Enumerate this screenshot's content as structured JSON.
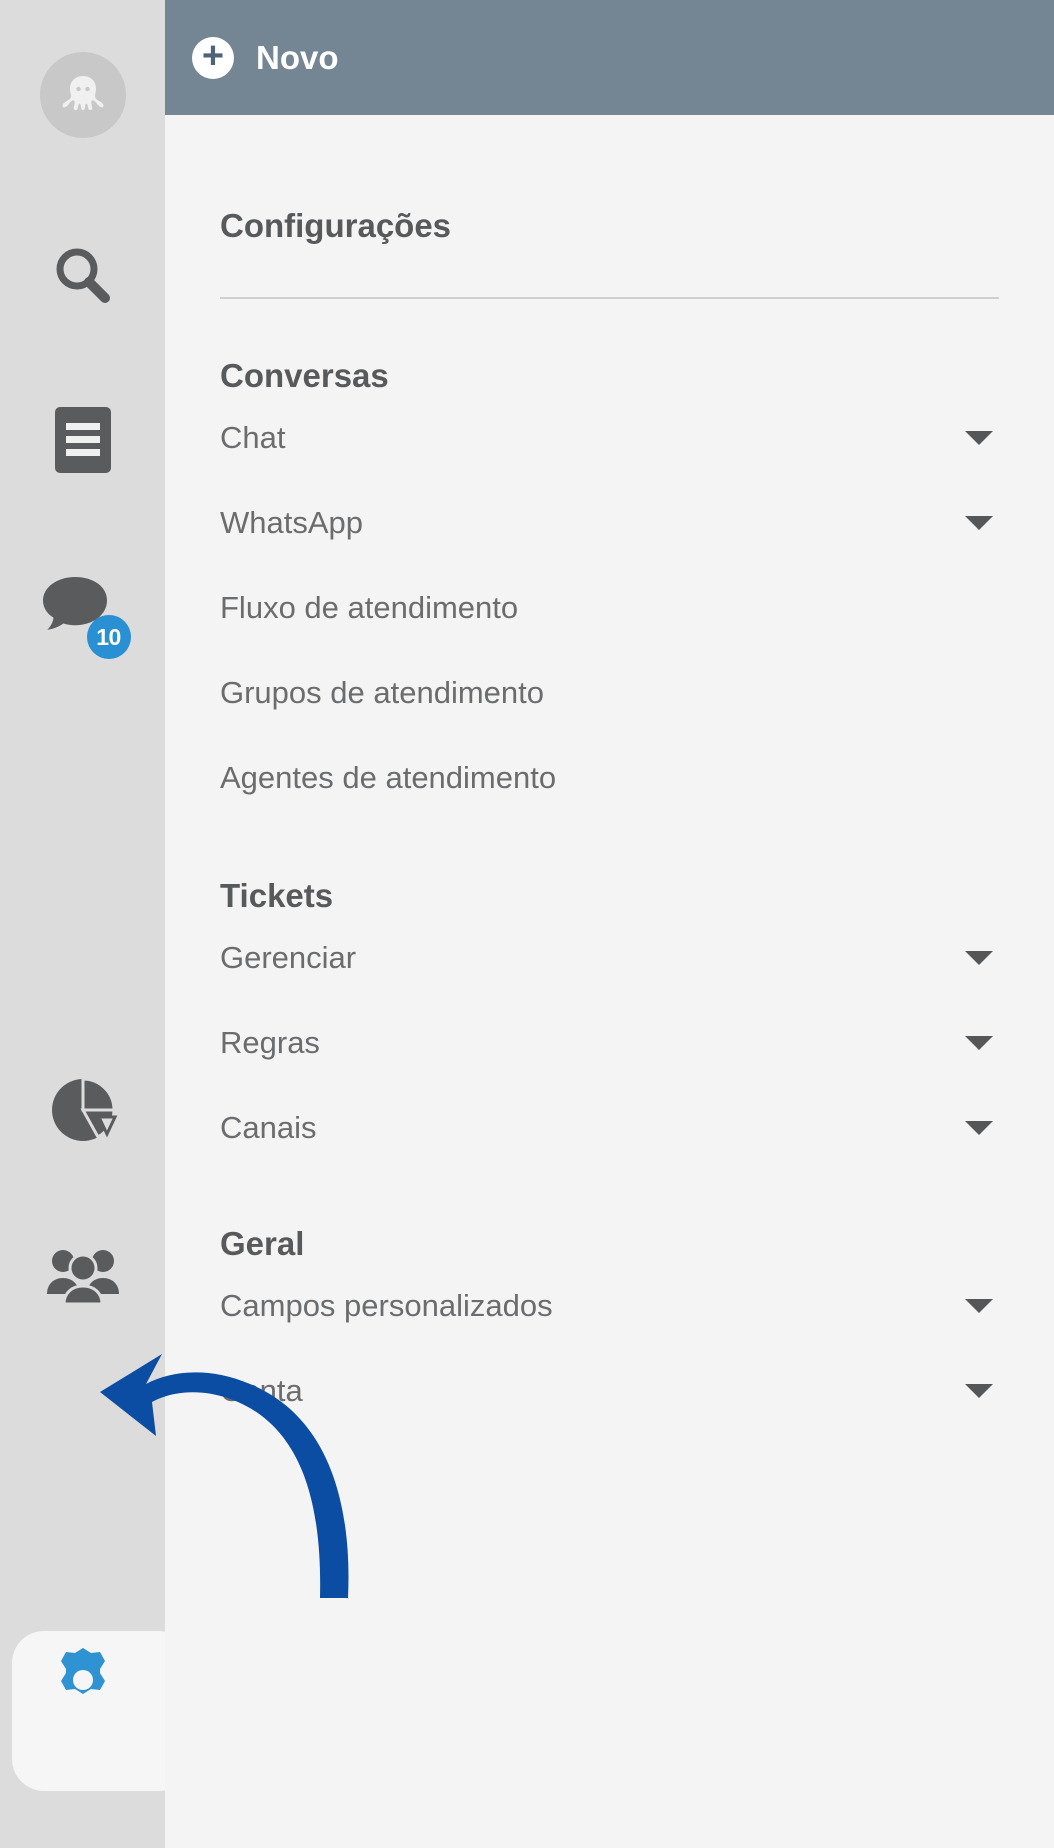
{
  "topbar": {
    "new_label": "Novo",
    "plus_icon": "plus-circle-icon",
    "background_color": "#748594"
  },
  "rail": {
    "background_color": "#dcdcdc",
    "items": [
      {
        "icon": "octopus-avatar-icon",
        "name": "user-avatar",
        "active": false
      },
      {
        "icon": "search-icon",
        "name": "search",
        "active": false
      },
      {
        "icon": "list-document-icon",
        "name": "documents",
        "active": false
      },
      {
        "icon": "chat-bubble-icon",
        "name": "conversations",
        "active": false,
        "badge": "10"
      },
      {
        "icon": "pie-chart-icon",
        "name": "reports",
        "active": false
      },
      {
        "icon": "people-group-icon",
        "name": "contacts",
        "active": false
      },
      {
        "icon": "gear-icon",
        "name": "settings",
        "active": true
      }
    ],
    "badge_color": "#2a90d4",
    "active_icon_color": "#2a90d4"
  },
  "menu": {
    "title": "Configurações",
    "sections": [
      {
        "heading": "Conversas",
        "items": [
          {
            "label": "Chat",
            "has_caret": true
          },
          {
            "label": "WhatsApp",
            "has_caret": true
          },
          {
            "label": "Fluxo de atendimento",
            "has_caret": false
          },
          {
            "label": "Grupos de atendimento",
            "has_caret": false
          },
          {
            "label": "Agentes de atendimento",
            "has_caret": false
          }
        ]
      },
      {
        "heading": "Tickets",
        "items": [
          {
            "label": "Gerenciar",
            "has_caret": true
          },
          {
            "label": "Regras",
            "has_caret": true
          },
          {
            "label": "Canais",
            "has_caret": true
          }
        ]
      },
      {
        "heading": "Geral",
        "items": [
          {
            "label": "Campos personalizados",
            "has_caret": true
          },
          {
            "label": "Conta",
            "has_caret": true
          }
        ]
      }
    ]
  },
  "annotation": {
    "type": "curved-arrow",
    "points_to": "gear-icon",
    "color": "#0b4da2"
  }
}
